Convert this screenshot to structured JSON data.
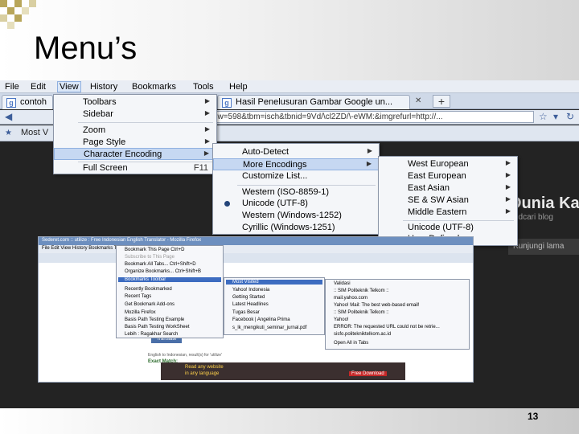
{
  "slide": {
    "title": "Menu’s",
    "page_number": "13"
  },
  "browser": {
    "menubar": [
      "File",
      "Edit",
      "View",
      "History",
      "Bookmarks",
      "Tools",
      "Help"
    ],
    "tabs": [
      {
        "label": "contoh",
        "icon": "google-icon"
      },
      {
        "label": "Hasil Penelusuran Gambar Google un...",
        "icon": "google-icon"
      }
    ],
    "new_tab": "+",
    "url": "&biw=598&tbm=isch&tbnid=9Vd/\\cl2ZD/\\-eWM:&imgrefurl=http://...",
    "bookmarks": [
      "Most V"
    ]
  },
  "view_menu": {
    "items": [
      {
        "label": "Toolbars",
        "arrow": true
      },
      {
        "label": "Sidebar",
        "arrow": true
      },
      {
        "label": "Zoom",
        "arrow": true
      },
      {
        "label": "Page Style",
        "arrow": true
      },
      {
        "label": "Character Encoding",
        "arrow": true
      },
      {
        "label": "Full Screen",
        "shortcut": "F11"
      }
    ]
  },
  "encoding_menu": {
    "items": [
      {
        "label": "Auto-Detect",
        "arrow": true
      },
      {
        "label": "More Encodings",
        "arrow": true
      },
      {
        "label": "Customize List..."
      },
      {
        "label": "Western (ISO-8859-1)"
      },
      {
        "label": "Unicode (UTF-8)",
        "checked": true
      },
      {
        "label": "Western (Windows-1252)"
      },
      {
        "label": "Cyrillic (Windows-1251)"
      }
    ]
  },
  "more_encodings_menu": {
    "items": [
      {
        "label": "West European",
        "arrow": true
      },
      {
        "label": "East European",
        "arrow": true
      },
      {
        "label": "East Asian",
        "arrow": true
      },
      {
        "label": "SE & SW Asian",
        "arrow": true
      },
      {
        "label": "Middle Eastern",
        "arrow": true
      },
      {
        "label": "Unicode (UTF-8)"
      },
      {
        "label": "User Defined"
      }
    ]
  },
  "page": {
    "heading": "Dunia Ka",
    "subheading": "sedcari blog",
    "button": "Kunjungi lama"
  },
  "mini_window": {
    "title": "Sederet.com :: utilize : Free Indonesian English Translator - Mozilla Firefox",
    "menubar": "File   Edit   View   History   Bookmarks   Tools   Help",
    "bookmarks_menu": [
      "Bookmark This Page   Ctrl+D",
      "Subscribe to This Page",
      "Bookmark All Tabs...   Ctrl+Shift+D",
      "Organize Bookmarks...   Ctrl+Shift+B",
      "Bookmarks Toolbar",
      "Recently Bookmarked",
      "Recent Tags",
      "Get Bookmark Add-ons",
      "Mozilla Firefox",
      "Basis Path Testing Example",
      "Basis Path Testing WorkSheet",
      "Lebih : Ragakhar Search"
    ],
    "toolbar_menu": [
      "Most Visited",
      "Yahoo! Indonesia",
      "Getting Started",
      "Latest Headlines",
      "Tugas Besar",
      "Facebook | Angelina Prima",
      "s_lk_mengikuti_seminar_jurnal.pdf"
    ],
    "most_visited_menu": [
      "Validasi",
      ":: SIM Politeknik Telkom ::",
      "mail.yahoo.com",
      "Yahoo! Mail: The best web-based email!",
      ":: SIM Politeknik Telkom ::",
      "Yahoo!",
      "ERROR: The requested URL could not be retrie...",
      "sisfo.politekniktelkom.ac.id",
      "Open All in Tabs"
    ],
    "translate_button": "Translate",
    "banner_text": [
      "Read any website",
      "in any language"
    ],
    "free_download": "Free Download",
    "exact_match": "Exact Match:",
    "result_line": "English to Indonesian, result(s) for 'utilize'"
  }
}
